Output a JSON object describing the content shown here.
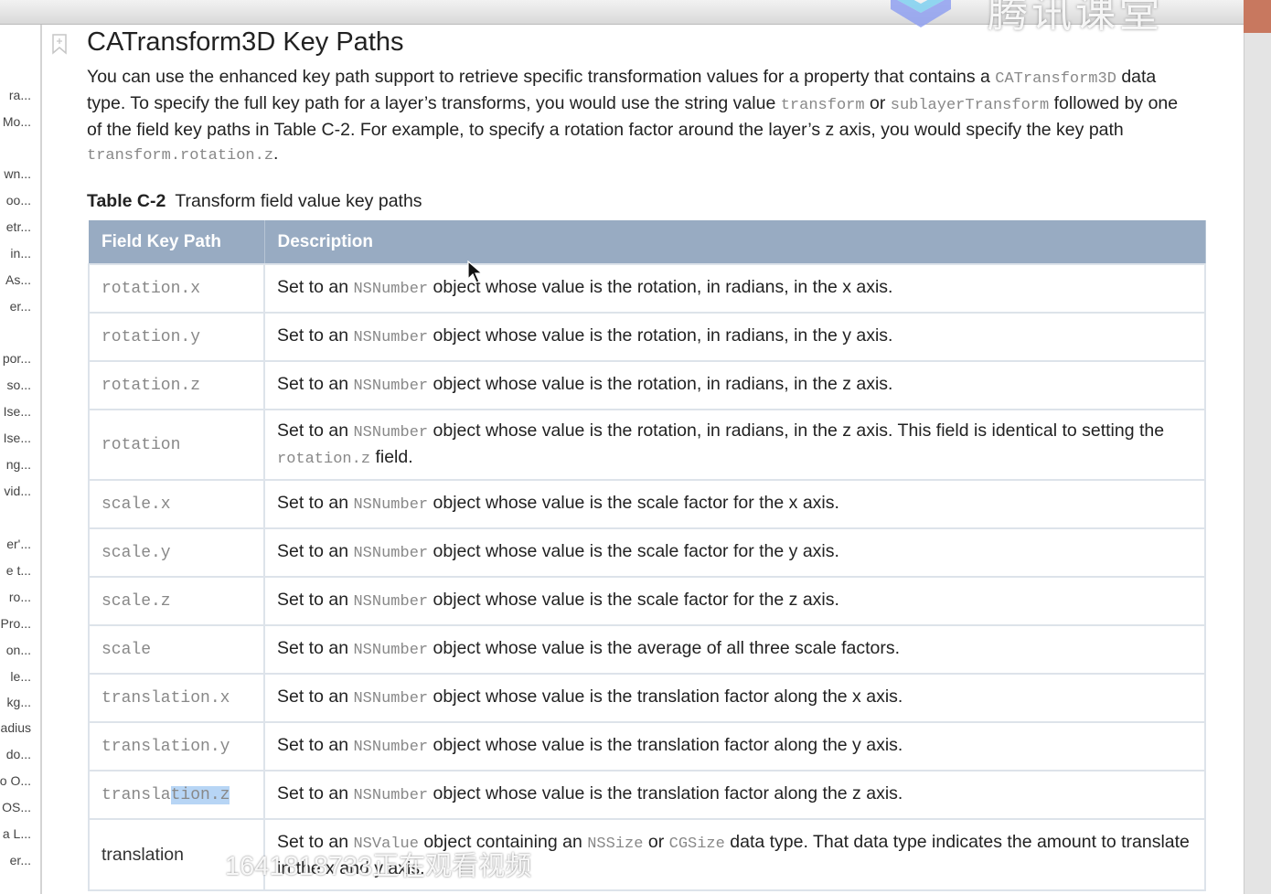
{
  "sidebar": {
    "items": [
      "ra...",
      "Mo...",
      "wn...",
      "oo...",
      "etr...",
      "in...",
      "As...",
      "er...",
      "por...",
      "so...",
      "Ise...",
      "Ise...",
      "ng...",
      "vid...",
      "er'...",
      "e t...",
      "ro...",
      "Pro...",
      "on...",
      "le...",
      "kg...",
      "adius",
      "do...",
      "o O...",
      "OS...",
      "a L...",
      "er..."
    ]
  },
  "page": {
    "title": "CATransform3D Key Paths",
    "intro": [
      {
        "t": "text",
        "v": "You can use the enhanced key path support to retrieve specific transformation values for a property that contains a "
      },
      {
        "t": "code",
        "v": "CATransform3D"
      },
      {
        "t": "text",
        "v": " data type. To specify the full key path for a layer’s transforms, you would use the string value "
      },
      {
        "t": "code",
        "v": "transform"
      },
      {
        "t": "text",
        "v": " or "
      },
      {
        "t": "code",
        "v": "sublayerTransform"
      },
      {
        "t": "text",
        "v": " followed by one of the field key paths in Table C-2. For example, to specify a rotation factor around the layer’s z axis, you would specify the key path "
      },
      {
        "t": "code",
        "v": "transform.rotation.z"
      },
      {
        "t": "text",
        "v": "."
      }
    ],
    "caption_label": "Table C-2",
    "caption_text": "Transform field value key paths"
  },
  "table": {
    "headers": [
      "Field Key Path",
      "Description"
    ],
    "rows": [
      {
        "key": "rotation.x",
        "desc": [
          {
            "t": "text",
            "v": "Set to an "
          },
          {
            "t": "code",
            "v": "NSNumber"
          },
          {
            "t": "text",
            "v": " object whose value is the rotation, in radians, in the x axis."
          }
        ]
      },
      {
        "key": "rotation.y",
        "desc": [
          {
            "t": "text",
            "v": "Set to an "
          },
          {
            "t": "code",
            "v": "NSNumber"
          },
          {
            "t": "text",
            "v": " object whose value is the rotation, in radians, in the y axis."
          }
        ]
      },
      {
        "key": "rotation.z",
        "desc": [
          {
            "t": "text",
            "v": "Set to an "
          },
          {
            "t": "code",
            "v": "NSNumber"
          },
          {
            "t": "text",
            "v": " object whose value is the rotation, in radians, in the z axis."
          }
        ]
      },
      {
        "key": "rotation",
        "desc": [
          {
            "t": "text",
            "v": "Set to an "
          },
          {
            "t": "code",
            "v": "NSNumber"
          },
          {
            "t": "text",
            "v": " object whose value is the rotation, in radians, in the z axis. This field is identical to setting the "
          },
          {
            "t": "code",
            "v": "rotation.z"
          },
          {
            "t": "text",
            "v": " field."
          }
        ]
      },
      {
        "key": "scale.x",
        "desc": [
          {
            "t": "text",
            "v": "Set to an "
          },
          {
            "t": "code",
            "v": "NSNumber"
          },
          {
            "t": "text",
            "v": " object whose value is the scale factor for the x axis."
          }
        ]
      },
      {
        "key": "scale.y",
        "desc": [
          {
            "t": "text",
            "v": "Set to an "
          },
          {
            "t": "code",
            "v": "NSNumber"
          },
          {
            "t": "text",
            "v": " object whose value is the scale factor for the y axis."
          }
        ]
      },
      {
        "key": "scale.z",
        "desc": [
          {
            "t": "text",
            "v": "Set to an "
          },
          {
            "t": "code",
            "v": "NSNumber"
          },
          {
            "t": "text",
            "v": " object whose value is the scale factor for the z axis."
          }
        ]
      },
      {
        "key": "scale",
        "desc": [
          {
            "t": "text",
            "v": "Set to an "
          },
          {
            "t": "code",
            "v": "NSNumber"
          },
          {
            "t": "text",
            "v": " object whose value is the average of all three scale factors."
          }
        ]
      },
      {
        "key": "translation.x",
        "desc": [
          {
            "t": "text",
            "v": "Set to an "
          },
          {
            "t": "code",
            "v": "NSNumber"
          },
          {
            "t": "text",
            "v": " object whose value is the translation factor along the x axis."
          }
        ]
      },
      {
        "key": "translation.y",
        "desc": [
          {
            "t": "text",
            "v": "Set to an "
          },
          {
            "t": "code",
            "v": "NSNumber"
          },
          {
            "t": "text",
            "v": " object whose value is the translation factor along the y axis."
          }
        ]
      },
      {
        "key": "translation.z",
        "key_pre": "transla",
        "key_sel": "tion.z",
        "desc": [
          {
            "t": "text",
            "v": "Set to an "
          },
          {
            "t": "code",
            "v": "NSNumber"
          },
          {
            "t": "text",
            "v": " object whose value is the translation factor along the z axis."
          }
        ]
      },
      {
        "key": "translation",
        "plain": true,
        "desc": [
          {
            "t": "text",
            "v": "Set to an "
          },
          {
            "t": "code",
            "v": "NSValue"
          },
          {
            "t": "text",
            "v": " object containing an "
          },
          {
            "t": "code",
            "v": "NSSize"
          },
          {
            "t": "text",
            "v": " or "
          },
          {
            "t": "code",
            "v": "CGSize"
          },
          {
            "t": "text",
            "v": " data type. That data type indicates the amount to translate in the x and y axis."
          }
        ]
      }
    ]
  },
  "watermark": {
    "logo_text": "腾讯课堂",
    "viewer_text": "1641818733正在观看视频"
  },
  "colors": {
    "header_bg": "#98abc2",
    "selection": "#b7d5f5"
  }
}
